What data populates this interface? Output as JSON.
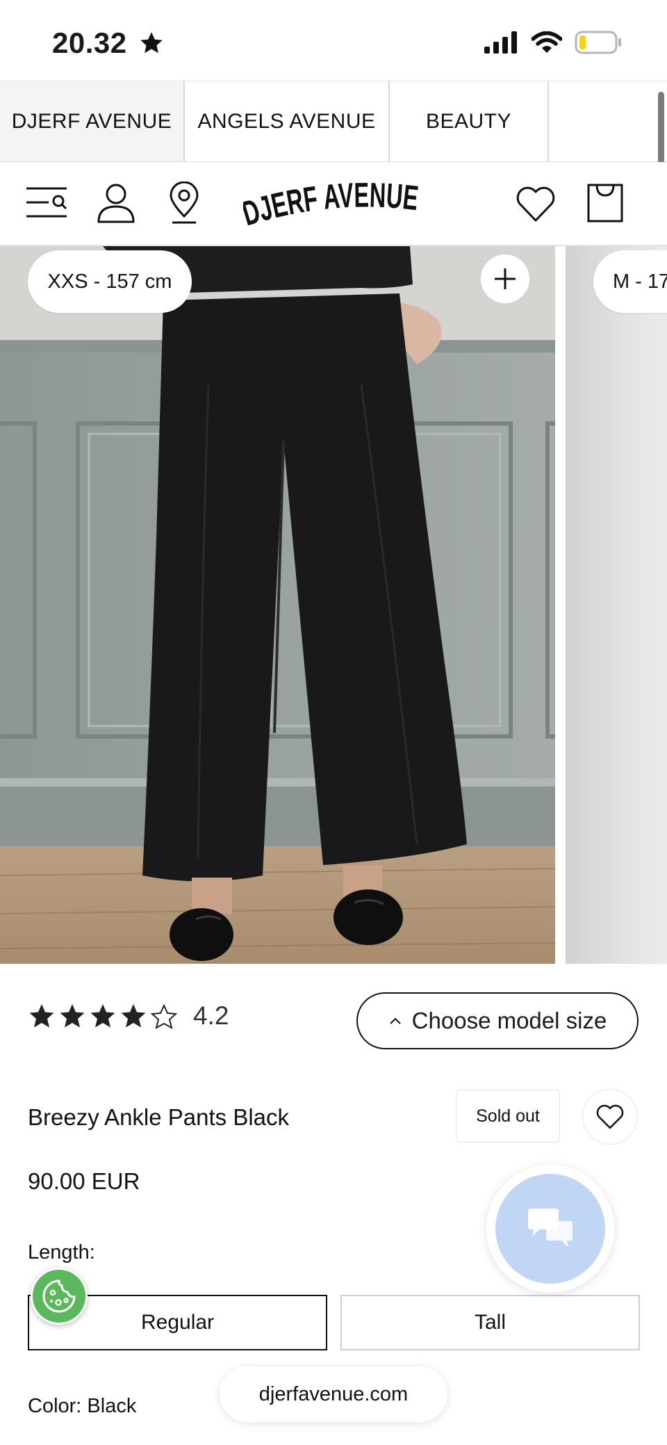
{
  "status_bar": {
    "time": "20.32",
    "time_icon": "star-icon"
  },
  "brand_tabs": [
    {
      "label": "DJERF AVENUE",
      "active": true
    },
    {
      "label": "ANGELS AVENUE",
      "active": false
    },
    {
      "label": "BEAUTY",
      "active": false
    }
  ],
  "header": {
    "logo": "DJERF AVENUE",
    "icons": [
      "menu-search-icon",
      "account-icon",
      "store-locator-icon",
      "wishlist-icon",
      "cart-icon"
    ]
  },
  "gallery": {
    "model_sizes": [
      "XXS - 157 cm",
      "M - 17"
    ],
    "zoom_icon": "plus-icon"
  },
  "product": {
    "rating": {
      "stars": 4,
      "max": 5,
      "value": "4.2"
    },
    "model_size_button": "Choose model size",
    "title": "Breezy Ankle Pants Black",
    "availability": "Sold out",
    "price": "90.00 EUR",
    "length_label": "Length:",
    "length_options": [
      "Regular",
      "Tall"
    ],
    "selected_length": "Regular",
    "color_label": "Color: Black"
  },
  "browser": {
    "url": "djerfavenue.com"
  },
  "colors": {
    "chat_bubble": "#c0d6f4",
    "cookie_badge": "#5cb85c",
    "text": "#111111"
  }
}
